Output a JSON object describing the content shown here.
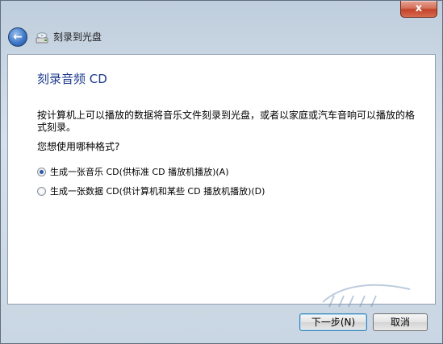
{
  "window": {
    "close_label": "x"
  },
  "nav": {
    "back_glyph": "←",
    "title": "刻录到光盘",
    "icon": "disc-burn-icon"
  },
  "content": {
    "heading": "刻录音频 CD",
    "description": "按计算机上可以播放的数据将音乐文件刻录到光盘，或者以家庭或汽车音响可以播放的格式刻录。",
    "question": "您想使用哪种格式?",
    "options": [
      {
        "label": "生成一张音乐 CD(供标准 CD 播放机播放)(A)",
        "checked": true
      },
      {
        "label": "生成一张数据 CD(供计算机和某些 CD 播放机播放)(D)",
        "checked": false
      }
    ]
  },
  "footer": {
    "next_label": "下一步(N)",
    "cancel_label": "取消"
  },
  "colors": {
    "heading": "#1e3b8c",
    "frame": "#c9d6e3",
    "close": "#c2432a"
  }
}
